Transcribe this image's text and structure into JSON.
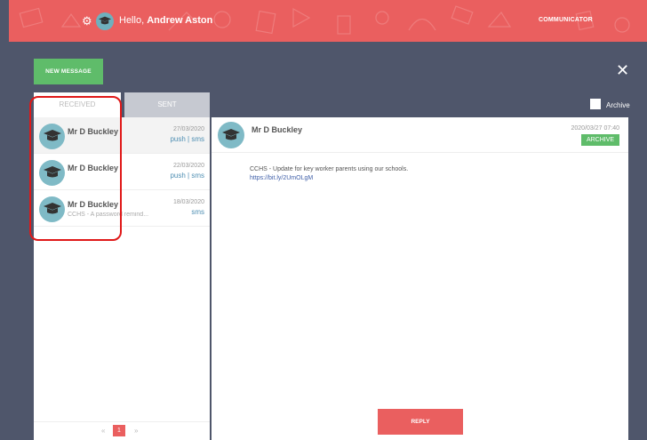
{
  "header": {
    "greeting": "Hello,",
    "user_name": "Andrew Aston",
    "app_name": "COMMUNICATOR",
    "settings_icon": "gear-icon",
    "brand_color": "#ea5f5f"
  },
  "toolbar": {
    "new_message_label": "NEW MESSAGE",
    "close_icon": "close-icon",
    "archive_label": "Archive"
  },
  "tabs": [
    {
      "label": "RECEIVED"
    },
    {
      "label": "SENT"
    }
  ],
  "messages": [
    {
      "sender": "Mr D Buckley",
      "preview": "",
      "date": "27/03/2020",
      "channels": "push | sms"
    },
    {
      "sender": "Mr D Buckley",
      "preview": "",
      "date": "22/03/2020",
      "channels": "push | sms"
    },
    {
      "sender": "Mr D Buckley",
      "preview": "CCHS - A password remind...",
      "date": "18/03/2020",
      "channels": "sms"
    }
  ],
  "pagination": {
    "prev": "«",
    "current_page": "1",
    "next": "»"
  },
  "detail": {
    "sender": "Mr D Buckley",
    "timestamp": "2020/03/27 07:40",
    "archive_button": "ARCHIVE",
    "body": "CCHS - Update for key worker parents using our schools.",
    "link": "https://bit.ly/2UmOLgM",
    "reply_label": "REPLY"
  }
}
